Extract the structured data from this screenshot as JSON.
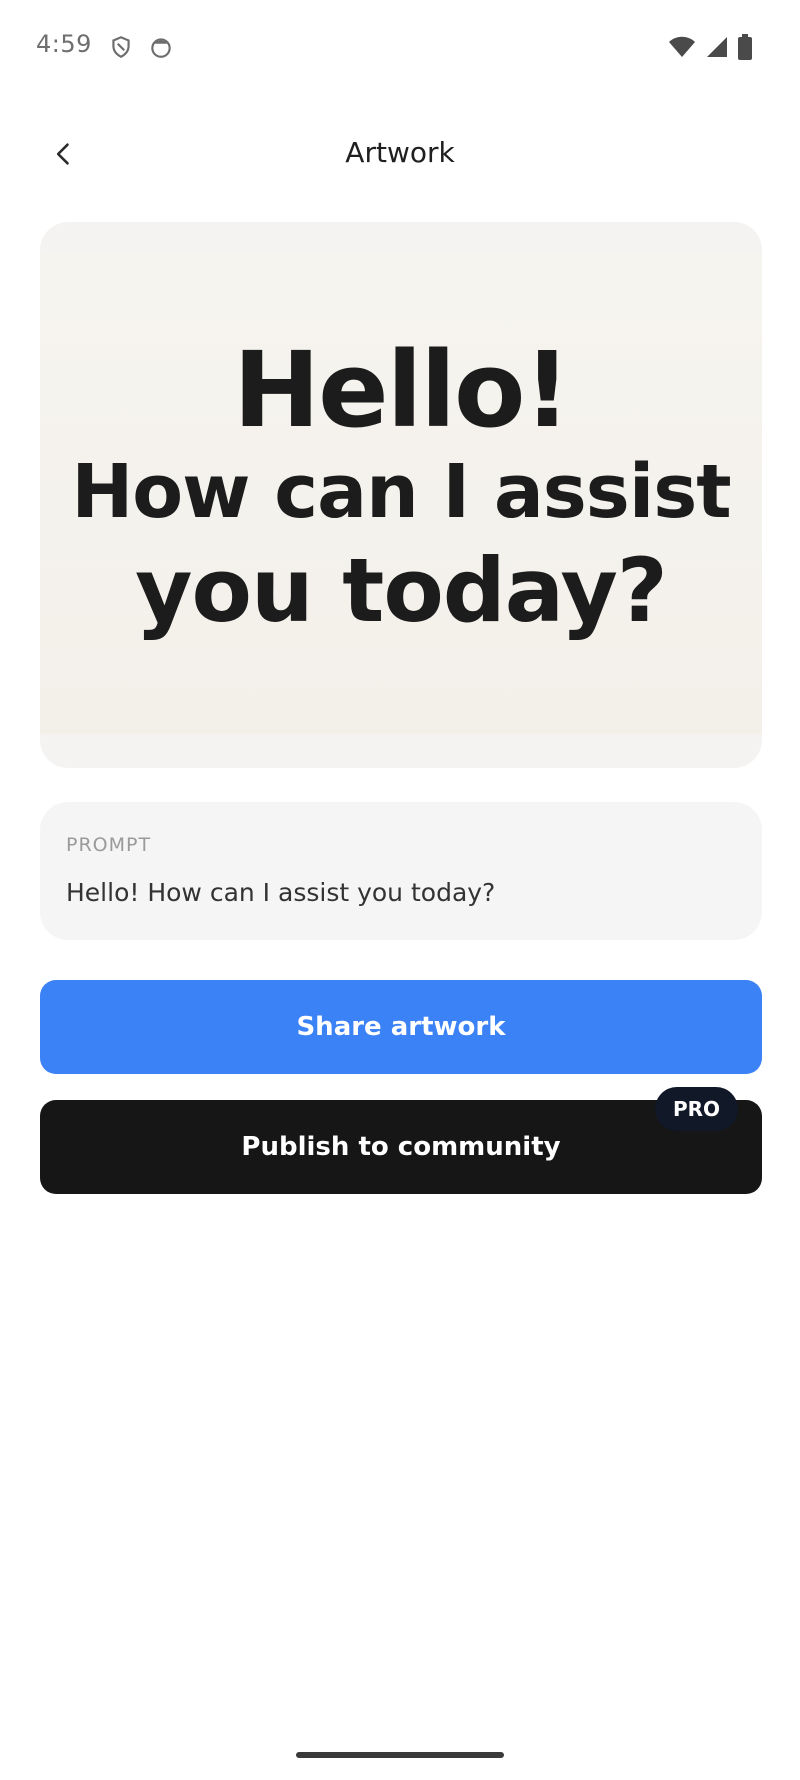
{
  "status_bar": {
    "time": "4:59",
    "left_icons": [
      "shield-icon",
      "face-icon"
    ],
    "right_icons": [
      "wifi-icon",
      "cellular-signal-icon",
      "battery-icon"
    ]
  },
  "app_bar": {
    "back_icon": "chevron-left-icon",
    "title": "Artwork"
  },
  "artwork": {
    "lines": [
      "Hello!",
      "How can I assist",
      "you today?"
    ]
  },
  "prompt": {
    "label": "PROMPT",
    "text": "Hello! How can I assist you today?"
  },
  "actions": {
    "share_label": "Share artwork",
    "publish_label": "Publish to community",
    "pro_badge": "PRO"
  },
  "colors": {
    "share_button": "#3b82f6",
    "publish_button": "#161616",
    "artwork_bg": "#f4f1ec"
  }
}
